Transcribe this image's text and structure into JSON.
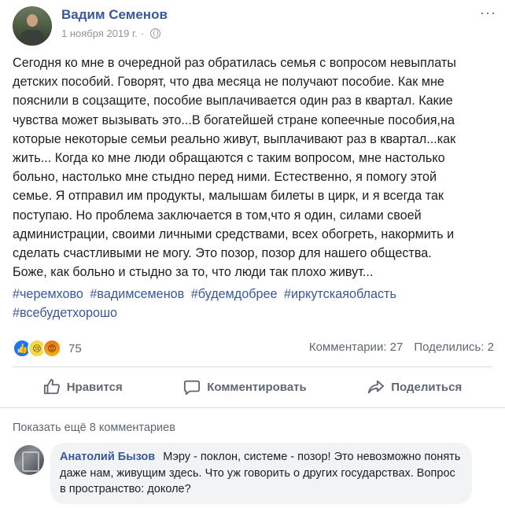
{
  "post": {
    "author": "Вадим Семенов",
    "date": "1 ноября 2019 г.",
    "more": "···",
    "text": "Сегодня ко мне в очередной раз обратилась семья с вопросом невыплаты\nдетских пособий. Говорят, что два месяца не получают пособие. Как мне\nпояснили в соцзащите, пособие выплачивается один раз в квартал. Какие\nчувства может вызывать это...В богатейшей стране копеечные пособия,на\nкоторые некоторые семьи реально живут, выплачивают раз в квартал...как\nжить... Когда ко мне люди обращаются с таким вопросом, мне настолько\nбольно, настолько мне стыдно перед ними. Естественно, я помогу этой\nсемье. Я отправил им продукты, малышам билеты в цирк, и я всегда так\nпоступаю. Но проблема заключается в том,что я один, силами своей\nадминистрации, своими личными средствами, всех обогреть, накормить и\nсделать счастливыми не могу. Это позор, позор для нашего общества.\nБоже, как больно и стыдно за то, что люди так плохо живут...",
    "hashtags": [
      "#черемхово",
      "#вадимсеменов",
      "#будемдобрее",
      "#иркутскаяобласть",
      "#всебудетхорошо"
    ]
  },
  "reactions": {
    "icons": [
      "like-icon",
      "sad-icon",
      "angry-icon"
    ],
    "count": "75"
  },
  "stats": {
    "comments": "Комментарии: 27",
    "shares": "Поделились: 2"
  },
  "actions": {
    "like": "Нравится",
    "comment": "Комментировать",
    "share": "Поделиться"
  },
  "comments": {
    "show_more": "Показать ещё 8 комментариев",
    "items": [
      {
        "author": "Анатолий Бызов",
        "text": "Мэру - поклон, системе - позор! Это невозможно понять даже нам, живущим здесь. Что уж говорить о других государствах. Вопрос в пространство: доколе?"
      }
    ]
  },
  "colors": {
    "link": "#385898",
    "muted": "#606770",
    "bubble": "#f2f3f5"
  }
}
